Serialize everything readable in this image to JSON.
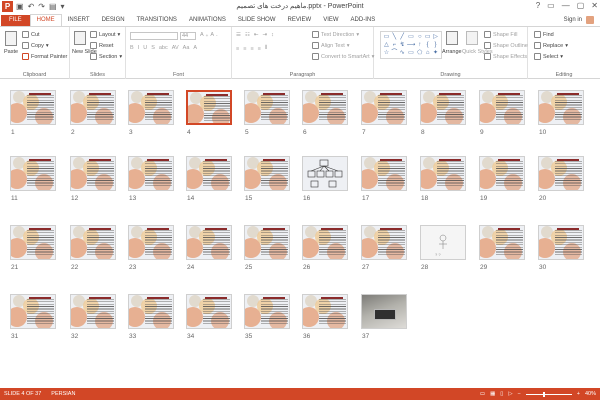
{
  "window": {
    "title": "ماهیم درخت های تصمیم.pptx - PowerPoint",
    "app_icon": "P",
    "qat": [
      "save-icon",
      "undo-icon",
      "redo-icon",
      "start-icon",
      "customize-icon"
    ],
    "controls": [
      "?",
      "▭",
      "—",
      "▢",
      "✕"
    ]
  },
  "ribbon": {
    "tabs": [
      "FILE",
      "HOME",
      "INSERT",
      "DESIGN",
      "TRANSITIONS",
      "ANIMATIONS",
      "SLIDE SHOW",
      "REVIEW",
      "VIEW",
      "ADD-INS"
    ],
    "active_tab": "HOME",
    "sign_in": "Sign in",
    "clipboard": {
      "label": "Clipboard",
      "paste": "Paste",
      "cut": "Cut",
      "copy": "Copy",
      "format_painter": "Format Painter"
    },
    "slides": {
      "label": "Slides",
      "new_slide": "New Slide",
      "layout": "Layout",
      "reset": "Reset",
      "section": "Section"
    },
    "font": {
      "label": "Font",
      "font_name": "",
      "font_size": "44",
      "style_buttons": [
        "B",
        "I",
        "U",
        "S",
        "abc",
        "AV",
        "Aa",
        "A"
      ]
    },
    "paragraph": {
      "label": "Paragraph",
      "text_direction": "Text Direction",
      "align_text": "Align Text",
      "convert": "Convert to SmartArt"
    },
    "drawing": {
      "label": "Drawing",
      "arrange": "Arrange",
      "quick_styles": "Quick Styles",
      "shape_fill": "Shape Fill",
      "shape_outline": "Shape Outline",
      "shape_effects": "Shape Effects",
      "shapes": [
        "▭",
        "╲",
        "╱",
        "▭",
        "○",
        "▭",
        "▷",
        "△",
        "⌐",
        "↯",
        "⟶",
        "↑",
        "{",
        "}",
        "☆",
        "⌒",
        "∿",
        "▭",
        "⬠",
        "⌂",
        "✦"
      ]
    },
    "editing": {
      "label": "Editing",
      "find": "Find",
      "replace": "Replace",
      "select": "Select"
    }
  },
  "slides": [
    {
      "n": "1",
      "kind": "text"
    },
    {
      "n": "2",
      "kind": "text"
    },
    {
      "n": "3",
      "kind": "text"
    },
    {
      "n": "4",
      "kind": "text",
      "selected": true
    },
    {
      "n": "5",
      "kind": "text"
    },
    {
      "n": "6",
      "kind": "text"
    },
    {
      "n": "7",
      "kind": "text"
    },
    {
      "n": "8",
      "kind": "text"
    },
    {
      "n": "9",
      "kind": "text"
    },
    {
      "n": "10",
      "kind": "text"
    },
    {
      "n": "11",
      "kind": "text"
    },
    {
      "n": "12",
      "kind": "text"
    },
    {
      "n": "13",
      "kind": "text"
    },
    {
      "n": "14",
      "kind": "text"
    },
    {
      "n": "15",
      "kind": "text"
    },
    {
      "n": "16",
      "kind": "diagram"
    },
    {
      "n": "17",
      "kind": "text"
    },
    {
      "n": "18",
      "kind": "text"
    },
    {
      "n": "19",
      "kind": "text"
    },
    {
      "n": "20",
      "kind": "text"
    },
    {
      "n": "21",
      "kind": "text"
    },
    {
      "n": "22",
      "kind": "text"
    },
    {
      "n": "23",
      "kind": "text"
    },
    {
      "n": "24",
      "kind": "text"
    },
    {
      "n": "25",
      "kind": "text"
    },
    {
      "n": "26",
      "kind": "text"
    },
    {
      "n": "27",
      "kind": "text"
    },
    {
      "n": "28",
      "kind": "blank"
    },
    {
      "n": "29",
      "kind": "text"
    },
    {
      "n": "30",
      "kind": "text"
    },
    {
      "n": "31",
      "kind": "text"
    },
    {
      "n": "32",
      "kind": "text"
    },
    {
      "n": "33",
      "kind": "text"
    },
    {
      "n": "34",
      "kind": "text"
    },
    {
      "n": "35",
      "kind": "text"
    },
    {
      "n": "36",
      "kind": "text"
    },
    {
      "n": "37",
      "kind": "photo"
    }
  ],
  "status": {
    "slide_info": "SLIDE 4 OF 37",
    "language": "PERSIAN",
    "zoom": "40%",
    "zoom_level": 0.4,
    "accent": "#d24726"
  }
}
